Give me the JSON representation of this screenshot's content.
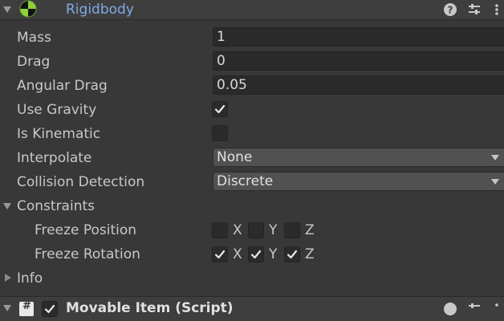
{
  "component": {
    "title": "Rigidbody",
    "enabled_icon": "rigidbody-icon",
    "header_icons": [
      "help-icon",
      "presets-icon",
      "context-menu-icon"
    ]
  },
  "properties": {
    "mass": {
      "label": "Mass",
      "value": "1"
    },
    "drag": {
      "label": "Drag",
      "value": "0"
    },
    "angular_drag": {
      "label": "Angular Drag",
      "value": "0.05"
    },
    "use_gravity": {
      "label": "Use Gravity",
      "checked": true
    },
    "is_kinematic": {
      "label": "Is Kinematic",
      "checked": false
    },
    "interpolate": {
      "label": "Interpolate",
      "value": "None"
    },
    "collision_detection": {
      "label": "Collision Detection",
      "value": "Discrete"
    }
  },
  "constraints": {
    "label": "Constraints",
    "freeze_position": {
      "label": "Freeze Position",
      "x": false,
      "y": false,
      "z": false
    },
    "freeze_rotation": {
      "label": "Freeze Rotation",
      "x": true,
      "y": true,
      "z": true
    },
    "axes": {
      "x": "X",
      "y": "Y",
      "z": "Z"
    }
  },
  "info": {
    "label": "Info"
  },
  "next_component": {
    "title": "Movable Item (Script)",
    "enabled": true
  },
  "colors": {
    "background": "#383838",
    "field": "#2a2a2a",
    "title_blue": "#7fa9e6"
  }
}
